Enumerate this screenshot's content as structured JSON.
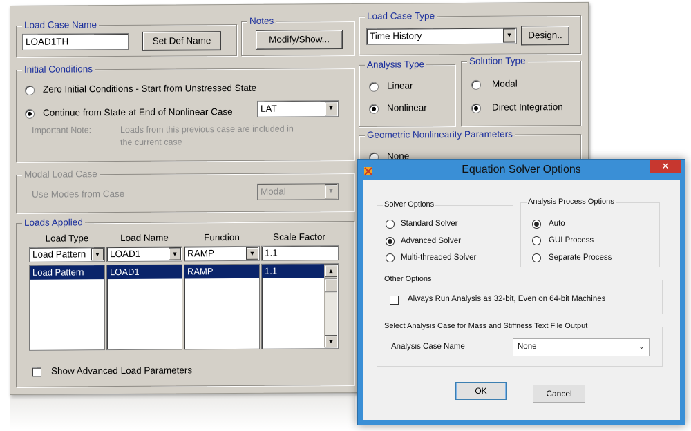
{
  "main": {
    "load_case_name": {
      "title": "Load Case Name",
      "value": "LOAD1TH",
      "set_def_button": "Set Def Name"
    },
    "notes": {
      "title": "Notes",
      "button": "Modify/Show..."
    },
    "load_case_type": {
      "title": "Load Case Type",
      "value": "Time History",
      "design_button": "Design.."
    },
    "initial_conditions": {
      "title": "Initial Conditions",
      "option1": "Zero Initial Conditions - Start from Unstressed State",
      "option2": "Continue from State at End of Nonlinear Case",
      "case_value": "LAT",
      "note_label": "Important Note:",
      "note_line1": "Loads from this previous case are included in",
      "note_line2": "the current case",
      "selected": 2
    },
    "analysis_type": {
      "title": "Analysis Type",
      "linear": "Linear",
      "nonlinear": "Nonlinear",
      "selected": "nonlinear"
    },
    "solution_type": {
      "title": "Solution Type",
      "modal": "Modal",
      "direct": "Direct Integration",
      "selected": "direct"
    },
    "geometric_nonlinearity": {
      "title": "Geometric Nonlinearity Parameters",
      "none": "None"
    },
    "modal_load_case": {
      "title": "Modal Load Case",
      "label": "Use Modes from Case",
      "value": "Modal"
    },
    "loads_applied": {
      "title": "Loads Applied",
      "headers": [
        "Load Type",
        "Load Name",
        "Function",
        "Scale Factor"
      ],
      "edit_row": [
        "Load Pattern",
        "LOAD1",
        "RAMP",
        "1.1"
      ],
      "rows": [
        [
          "Load Pattern",
          "LOAD1",
          "RAMP",
          "1.1"
        ]
      ],
      "show_advanced": "Show Advanced Load Parameters"
    }
  },
  "solver_dialog": {
    "title": "Equation Solver Options",
    "close_icon": "close-icon",
    "solver_options": {
      "title": "Solver Options",
      "items": [
        "Standard Solver",
        "Advanced Solver",
        "Multi-threaded Solver"
      ],
      "selected": 1
    },
    "process_options": {
      "title": "Analysis Process Options",
      "items": [
        "Auto",
        "GUI Process",
        "Separate Process"
      ],
      "selected": 0
    },
    "other_options": {
      "title": "Other Options",
      "checkbox": "Always Run Analysis as 32-bit, Even on 64-bit Machines"
    },
    "text_output": {
      "title": "Select Analysis Case for Mass and Stiffness Text File Output",
      "label": "Analysis Case Name",
      "value": "None"
    },
    "ok": "OK",
    "cancel": "Cancel"
  }
}
